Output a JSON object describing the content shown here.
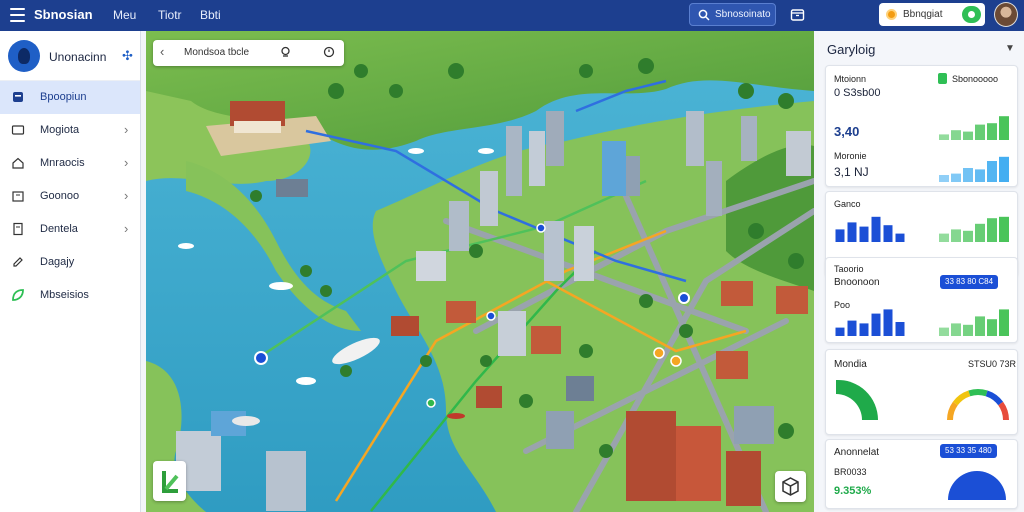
{
  "header": {
    "brand": "Sbnosian",
    "nav": [
      "Meu",
      "Tiotr",
      "Bbti"
    ],
    "search_label": "Sbnosoinato",
    "user_label": "Bbnqgiat"
  },
  "sidebar": {
    "title": "Unonacinn",
    "items": [
      {
        "label": "Bpoopiun",
        "icon": "layers-icon",
        "chevron": false,
        "active": true
      },
      {
        "label": "Mogiota",
        "icon": "folder-icon",
        "chevron": true,
        "active": false
      },
      {
        "label": "Mnraocis",
        "icon": "home-icon",
        "chevron": true,
        "active": false
      },
      {
        "label": "Goonoo",
        "icon": "building-icon",
        "chevron": true,
        "active": false
      },
      {
        "label": "Dentela",
        "icon": "document-icon",
        "chevron": true,
        "active": false
      },
      {
        "label": "Dagajy",
        "icon": "edit-icon",
        "chevron": false,
        "active": false
      },
      {
        "label": "Mbseisios",
        "icon": "leaf-icon",
        "chevron": false,
        "active": false
      }
    ]
  },
  "map": {
    "search_text": "Mondsoa tbcle"
  },
  "panel": {
    "title": "Garyloig",
    "cards": [
      {
        "label": "Mtoionn",
        "badge": "Sbonooooo",
        "value": "0 S3sb00",
        "value2": "3,40",
        "sub": "Moronie",
        "value3": "3,1 NJ",
        "spark1": [
          0.2,
          0.35,
          0.3,
          0.55,
          0.6,
          0.85
        ],
        "spark2": [
          0.25,
          0.3,
          0.5,
          0.45,
          0.75,
          0.9
        ]
      },
      {
        "label": "Ganco",
        "bars": [
          0.45,
          0.7,
          0.55,
          0.9,
          0.6,
          0.3
        ],
        "spark": [
          0.3,
          0.45,
          0.4,
          0.65,
          0.85,
          0.9
        ]
      },
      {
        "label": "Taoorio",
        "value": "Bnoonoon",
        "badge": "33 83 80 C84",
        "sub": "Poo",
        "bars": [
          0.3,
          0.55,
          0.45,
          0.8,
          0.95,
          0.5
        ],
        "spark": [
          0.3,
          0.45,
          0.4,
          0.7,
          0.6,
          0.95
        ]
      },
      {
        "label": "Mondia",
        "value": "STSU0 73R",
        "gauge": 0.62
      },
      {
        "label": "Anonnelat",
        "badge": "53 33 35 480",
        "value": "9.353%",
        "sub": "BR0033",
        "gauge": 0.78
      }
    ]
  },
  "colors": {
    "accent": "#1d3f8f",
    "active_bg": "#dbe6fb",
    "green": "#3bbf4d",
    "blue": "#1b4fd6",
    "water": "#3aa7c9"
  }
}
